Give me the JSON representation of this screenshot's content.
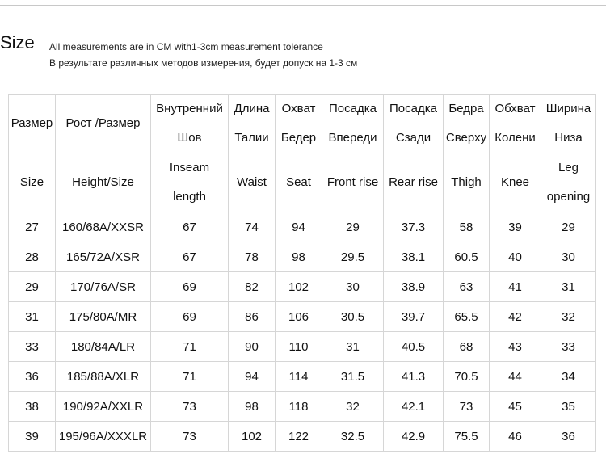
{
  "title": "Size",
  "notes": [
    "All measurements are in CM with1-3cm measurement tolerance",
    "В результате различных методов измерения, будет допуск на 1-3 см"
  ],
  "header_ru": [
    [
      "Размер"
    ],
    [
      "Рост /Размер"
    ],
    [
      "Внутренний",
      "Шов"
    ],
    [
      "Длина",
      "Талии"
    ],
    [
      "Охват",
      "Бедер"
    ],
    [
      "Посадка",
      "Впереди"
    ],
    [
      "Посадка",
      "Сзади"
    ],
    [
      "Бедра",
      "Сверху"
    ],
    [
      "Обхват",
      "Колени"
    ],
    [
      "Ширина",
      "Низа"
    ]
  ],
  "header_en": [
    [
      "Size"
    ],
    [
      "Height/Size"
    ],
    [
      "Inseam",
      "length"
    ],
    [
      "Waist"
    ],
    [
      "Seat"
    ],
    [
      "Front rise"
    ],
    [
      "Rear rise"
    ],
    [
      "Thigh"
    ],
    [
      "Knee"
    ],
    [
      "Leg",
      "opening"
    ]
  ],
  "rows": [
    [
      "27",
      "160/68A/XXSR",
      "67",
      "74",
      "94",
      "29",
      "37.3",
      "58",
      "39",
      "29"
    ],
    [
      "28",
      "165/72A/XSR",
      "67",
      "78",
      "98",
      "29.5",
      "38.1",
      "60.5",
      "40",
      "30"
    ],
    [
      "29",
      "170/76A/SR",
      "69",
      "82",
      "102",
      "30",
      "38.9",
      "63",
      "41",
      "31"
    ],
    [
      "31",
      "175/80A/MR",
      "69",
      "86",
      "106",
      "30.5",
      "39.7",
      "65.5",
      "42",
      "32"
    ],
    [
      "33",
      "180/84A/LR",
      "71",
      "90",
      "110",
      "31",
      "40.5",
      "68",
      "43",
      "33"
    ],
    [
      "36",
      "185/88A/XLR",
      "71",
      "94",
      "114",
      "31.5",
      "41.3",
      "70.5",
      "44",
      "34"
    ],
    [
      "38",
      "190/92A/XXLR",
      "73",
      "98",
      "118",
      "32",
      "42.1",
      "73",
      "45",
      "35"
    ],
    [
      "39",
      "195/96A/XXXLR",
      "73",
      "102",
      "122",
      "32.5",
      "42.9",
      "75.5",
      "46",
      "36"
    ]
  ]
}
